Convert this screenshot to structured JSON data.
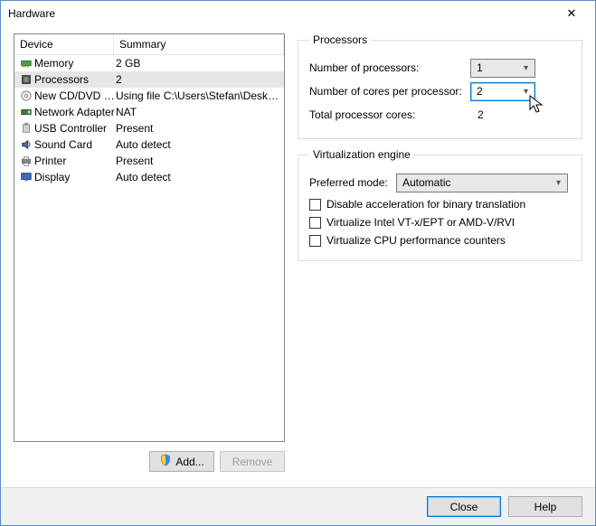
{
  "window": {
    "title": "Hardware",
    "close_label": "✕"
  },
  "device_table": {
    "header_device": "Device",
    "header_summary": "Summary"
  },
  "devices": [
    {
      "icon": "memory",
      "name": "Memory",
      "summary": "2 GB",
      "selected": false
    },
    {
      "icon": "cpu",
      "name": "Processors",
      "summary": "2",
      "selected": true
    },
    {
      "icon": "cd",
      "name": "New CD/DVD (...",
      "summary": "Using file C:\\Users\\Stefan\\Deskto...",
      "selected": false
    },
    {
      "icon": "nic",
      "name": "Network Adapter",
      "summary": "NAT",
      "selected": false
    },
    {
      "icon": "usb",
      "name": "USB Controller",
      "summary": "Present",
      "selected": false
    },
    {
      "icon": "sound",
      "name": "Sound Card",
      "summary": "Auto detect",
      "selected": false
    },
    {
      "icon": "printer",
      "name": "Printer",
      "summary": "Present",
      "selected": false
    },
    {
      "icon": "display",
      "name": "Display",
      "summary": "Auto detect",
      "selected": false
    }
  ],
  "left_buttons": {
    "add": "Add...",
    "remove": "Remove"
  },
  "processors_group": {
    "legend": "Processors",
    "num_procs_label": "Number of processors:",
    "num_procs_value": "1",
    "cores_per_label": "Number of cores per processor:",
    "cores_per_value": "2",
    "total_cores_label": "Total processor cores:",
    "total_cores_value": "2"
  },
  "virt_group": {
    "legend": "Virtualization engine",
    "pref_mode_label": "Preferred mode:",
    "pref_mode_value": "Automatic",
    "chk1": "Disable acceleration for binary translation",
    "chk2": "Virtualize Intel VT-x/EPT or AMD-V/RVI",
    "chk3": "Virtualize CPU performance counters"
  },
  "bottom": {
    "close": "Close",
    "help": "Help"
  }
}
